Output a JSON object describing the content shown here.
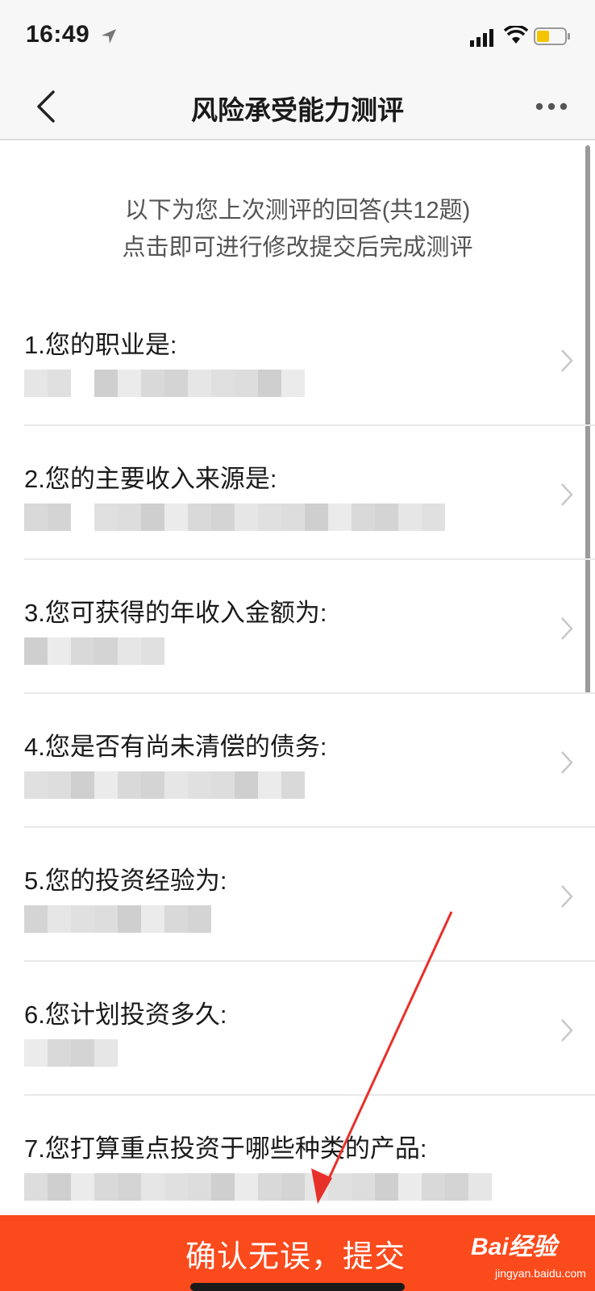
{
  "status_bar": {
    "time": "16:49"
  },
  "nav": {
    "title": "风险承受能力测评"
  },
  "intro": {
    "line1": "以下为您上次测评的回答(共12题)",
    "line2": "点击即可进行修改提交后完成测评"
  },
  "questions": [
    {
      "title": "1.您的职业是:"
    },
    {
      "title": "2.您的主要收入来源是:"
    },
    {
      "title": "3.您可获得的年收入金额为:"
    },
    {
      "title": "4.您是否有尚未清偿的债务:"
    },
    {
      "title": "5.您的投资经验为:"
    },
    {
      "title": "6.您计划投资多久:"
    },
    {
      "title": "7.您打算重点投资于哪些种类的产品:"
    }
  ],
  "submit": {
    "label": "确认无误，提交"
  },
  "watermark": {
    "logo": "Bai经验",
    "url": "jingyan.baidu.com"
  },
  "colors": {
    "accent": "#fb4a1c",
    "annotation_arrow": "#e8302a"
  }
}
